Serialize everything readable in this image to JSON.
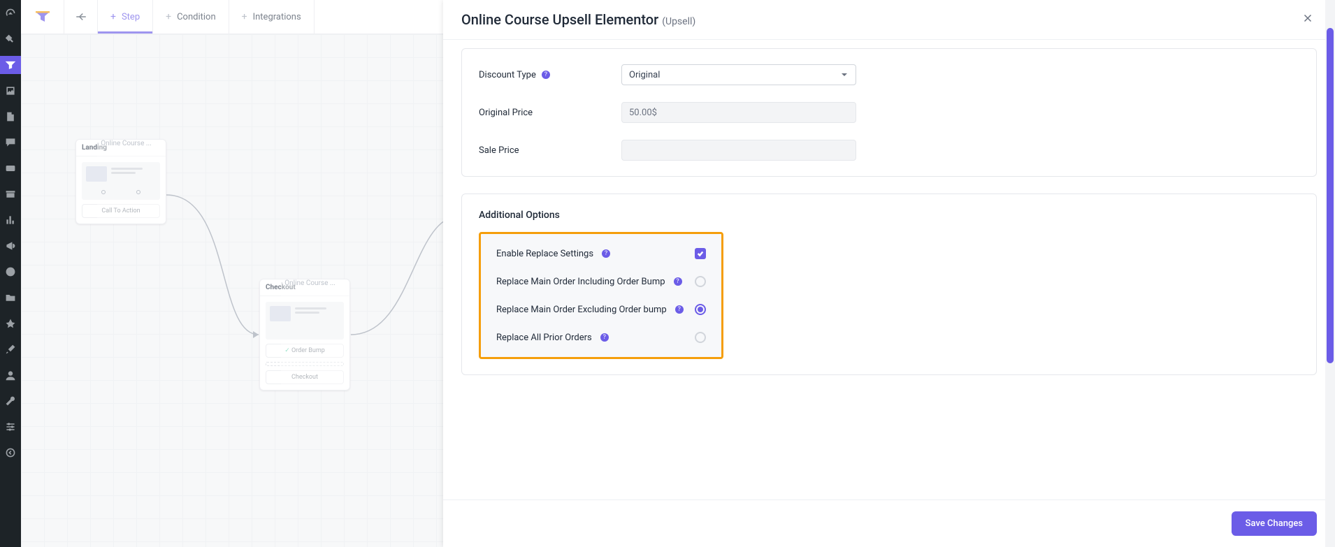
{
  "topbar": {
    "tabs": {
      "step": "Step",
      "condition": "Condition",
      "integrations": "Integrations"
    }
  },
  "canvas": {
    "nodes": {
      "landing": {
        "title_strong": "Landing",
        "title_dim": " - Online Course ...",
        "button": "Call To Action"
      },
      "checkout": {
        "title_strong": "Checkout",
        "title_dim": " - Online Course ...",
        "btn_bump": "Order Bump",
        "btn_checkout": "Checkout"
      }
    }
  },
  "panel": {
    "title_main": "Online Course Upsell Elementor ",
    "title_sub": "(Upsell)",
    "pricing": {
      "discount_label": "Discount Type",
      "discount_value": "Original",
      "original_label": "Original Price",
      "original_value": "50.00$",
      "sale_label": "Sale Price",
      "sale_value": ""
    },
    "additional_title": "Additional Options",
    "options": {
      "enable_replace": "Enable Replace Settings",
      "replace_incl": "Replace Main Order Including Order Bump",
      "replace_excl": "Replace Main Order Excluding Order bump",
      "replace_all": "Replace All Prior Orders"
    },
    "save_label": "Save Changes"
  }
}
